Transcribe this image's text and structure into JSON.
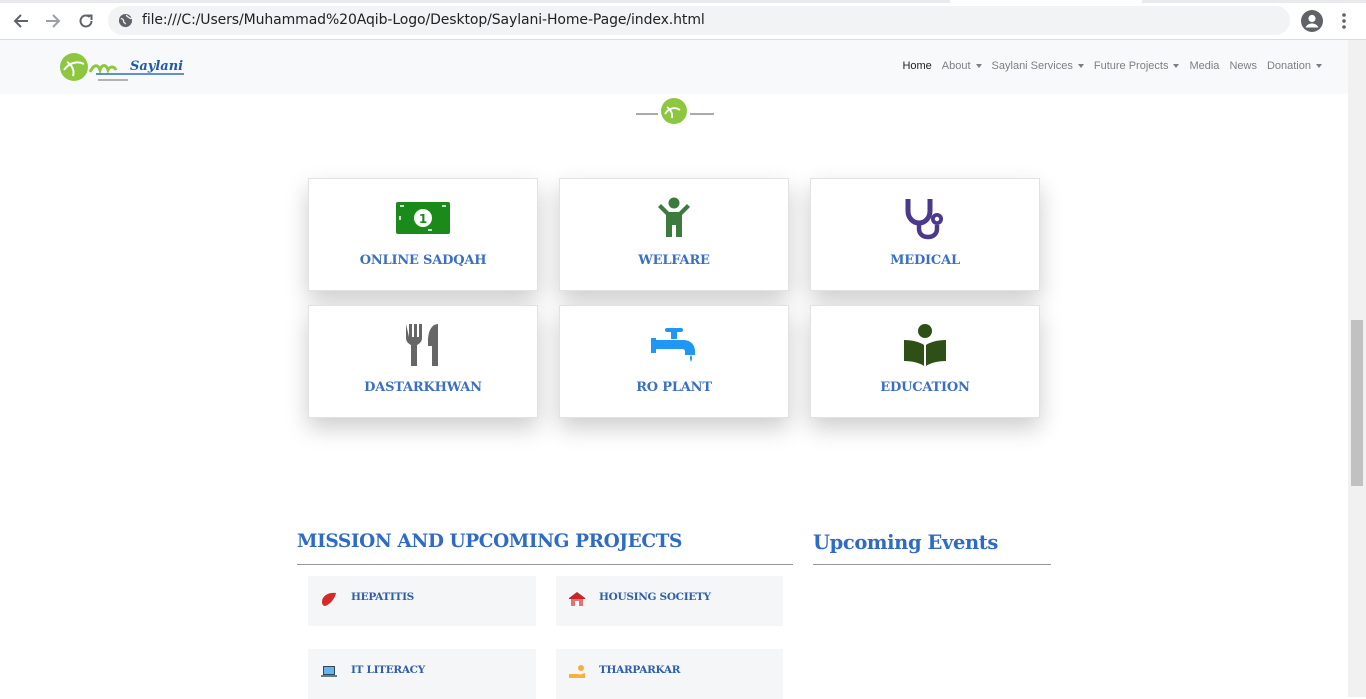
{
  "browser": {
    "url": "file:///C:/Users/Muhammad%20Aqib-Logo/Desktop/Saylani-Home-Page/index.html"
  },
  "navbar": {
    "logo_text": "Saylani",
    "items": [
      {
        "label": "Home",
        "dropdown": false
      },
      {
        "label": "About",
        "dropdown": true
      },
      {
        "label": "Saylani Services",
        "dropdown": true
      },
      {
        "label": "Future Projects",
        "dropdown": true
      },
      {
        "label": "Media",
        "dropdown": false
      },
      {
        "label": "News",
        "dropdown": false
      },
      {
        "label": "Donation",
        "dropdown": true
      }
    ]
  },
  "services": [
    {
      "label": "ONLINE SADQAH",
      "icon": "money-icon",
      "color": "#1a8a1a"
    },
    {
      "label": "WELFARE",
      "icon": "person-icon",
      "color": "#3d7a3d"
    },
    {
      "label": "MEDICAL",
      "icon": "stethoscope-icon",
      "color": "#4b3a8c"
    },
    {
      "label": "DASTARKHWAN",
      "icon": "utensils-icon",
      "color": "#666666"
    },
    {
      "label": "RO PLANT",
      "icon": "faucet-icon",
      "color": "#2196f3"
    },
    {
      "label": "EDUCATION",
      "icon": "book-reader-icon",
      "color": "#2e5016"
    }
  ],
  "mission": {
    "title": "MISSION AND UPCOMING PROJECTS",
    "projects": [
      {
        "label": "HEPATITIS",
        "icon": "liver-icon"
      },
      {
        "label": "HOUSING SOCIETY",
        "icon": "house-icon"
      },
      {
        "label": "IT LITERACY",
        "icon": "laptop-icon"
      },
      {
        "label": "THARPARKAR",
        "icon": "hand-water-icon"
      }
    ]
  },
  "events": {
    "title": "Upcoming Events"
  },
  "colors": {
    "accent": "#3a6fc4",
    "navbar_bg": "#f8f9fa"
  }
}
